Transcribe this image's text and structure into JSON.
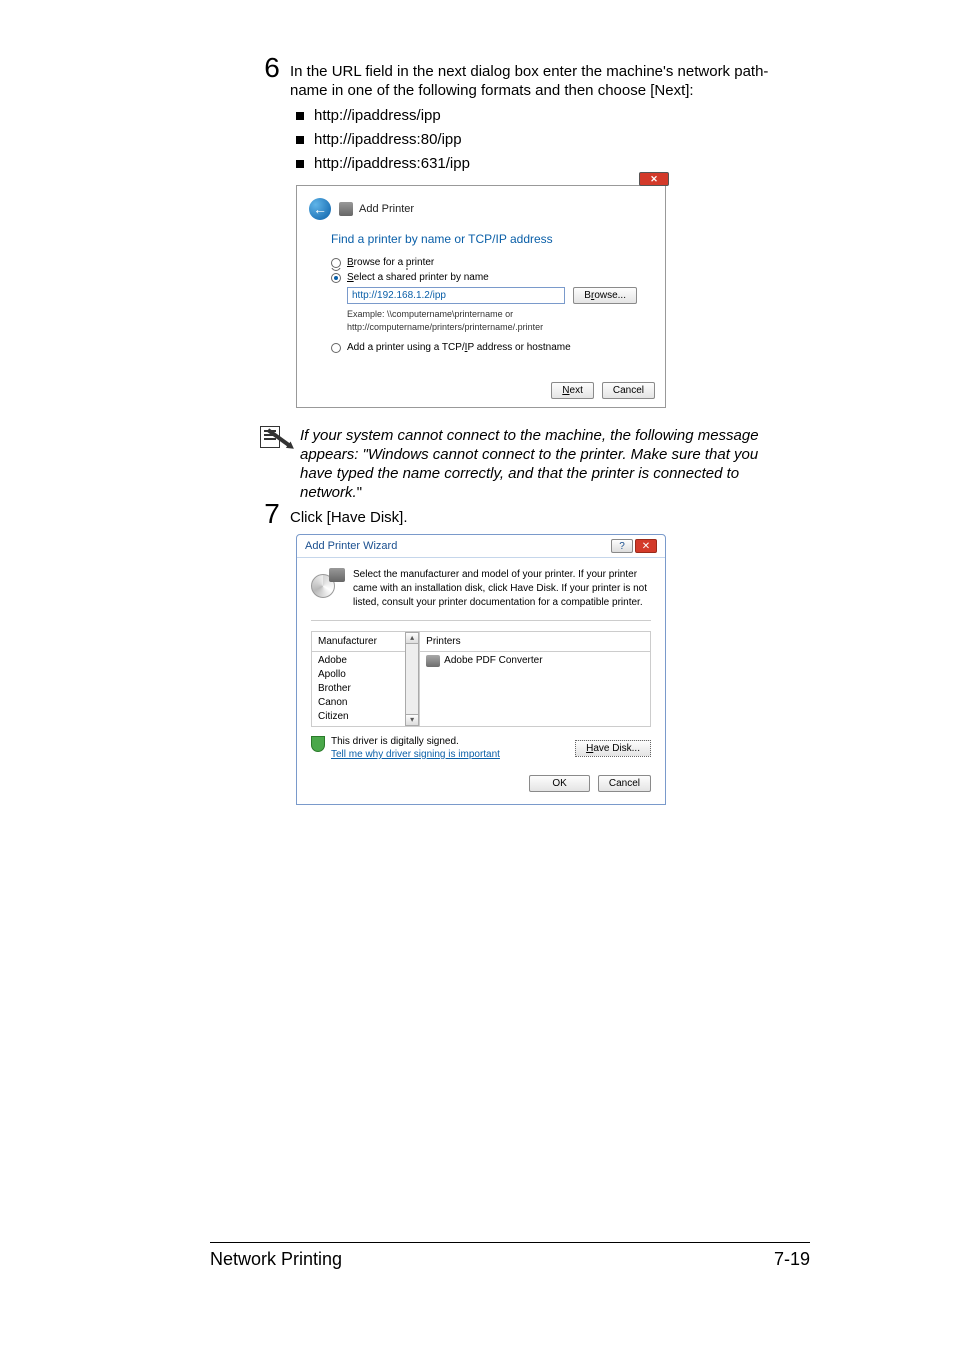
{
  "step6": {
    "num": "6",
    "text_a": "In the URL field in the next dialog box enter the machine's network path-",
    "text_b": "name in one of the following formats and then choose [Next]:",
    "bullets": [
      "http://ipaddress/ipp",
      "http://ipaddress:80/ipp",
      "http://ipaddress:631/ipp"
    ]
  },
  "dialog1": {
    "close_x": "✕",
    "back_arrow": "←",
    "title": "Add Printer",
    "heading": "Find a printer by name or TCP/IP address",
    "opt_browse_pre": "B",
    "opt_browse_post": "rowse for a printer",
    "opt_select_pre": "S",
    "opt_select_post": "elect a shared printer by name",
    "url_value": "http://192.168.1.2/ipp",
    "browse_pre": "B",
    "browse_mid": "r",
    "browse_post": "owse...",
    "example_l1": "Example: \\\\computername\\printername or",
    "example_l2": "http://computername/printers/printername/.printer",
    "opt_tcpip_a": "Add a printer using a TCP/",
    "opt_tcpip_u": "I",
    "opt_tcpip_b": "P address or hostname",
    "next_pre": "",
    "next_u": "N",
    "next_post": "ext",
    "cancel": "Cancel"
  },
  "note": {
    "line1": "If your system cannot connect to the machine, the following message",
    "line2": "appears:",
    "quoted1": " \"Windows cannot connect to the printer. Make sure that you",
    "line3": "have typed the name correctly, and that the printer is connected to",
    "line4": "network.",
    "line4_end": "\""
  },
  "step7": {
    "num": "7",
    "text": "Click [Have Disk]."
  },
  "dialog2": {
    "title": "Add Printer Wizard",
    "help": "?",
    "close_x": "✕",
    "intro": "Select the manufacturer and model of your printer. If your printer came with an installation disk, click Have Disk. If your printer is not listed, consult your printer documentation for a compatible printer.",
    "hdr_manu": "Manufacturer",
    "hdr_prn": "Printers",
    "manufacturers": [
      "Adobe",
      "Apollo",
      "Brother",
      "Canon",
      "Citizen"
    ],
    "printer_entry": "Adobe PDF Converter",
    "scroll_up": "▴",
    "scroll_down": "▾",
    "signed": "This driver is digitally signed.",
    "signlink": "Tell me why driver signing is important",
    "have_disk_pre": "",
    "have_disk_u": "H",
    "have_disk_post": "ave Disk...",
    "ok": "OK",
    "cancel": "Cancel"
  },
  "footer": {
    "left": "Network Printing",
    "right": "7-19"
  }
}
